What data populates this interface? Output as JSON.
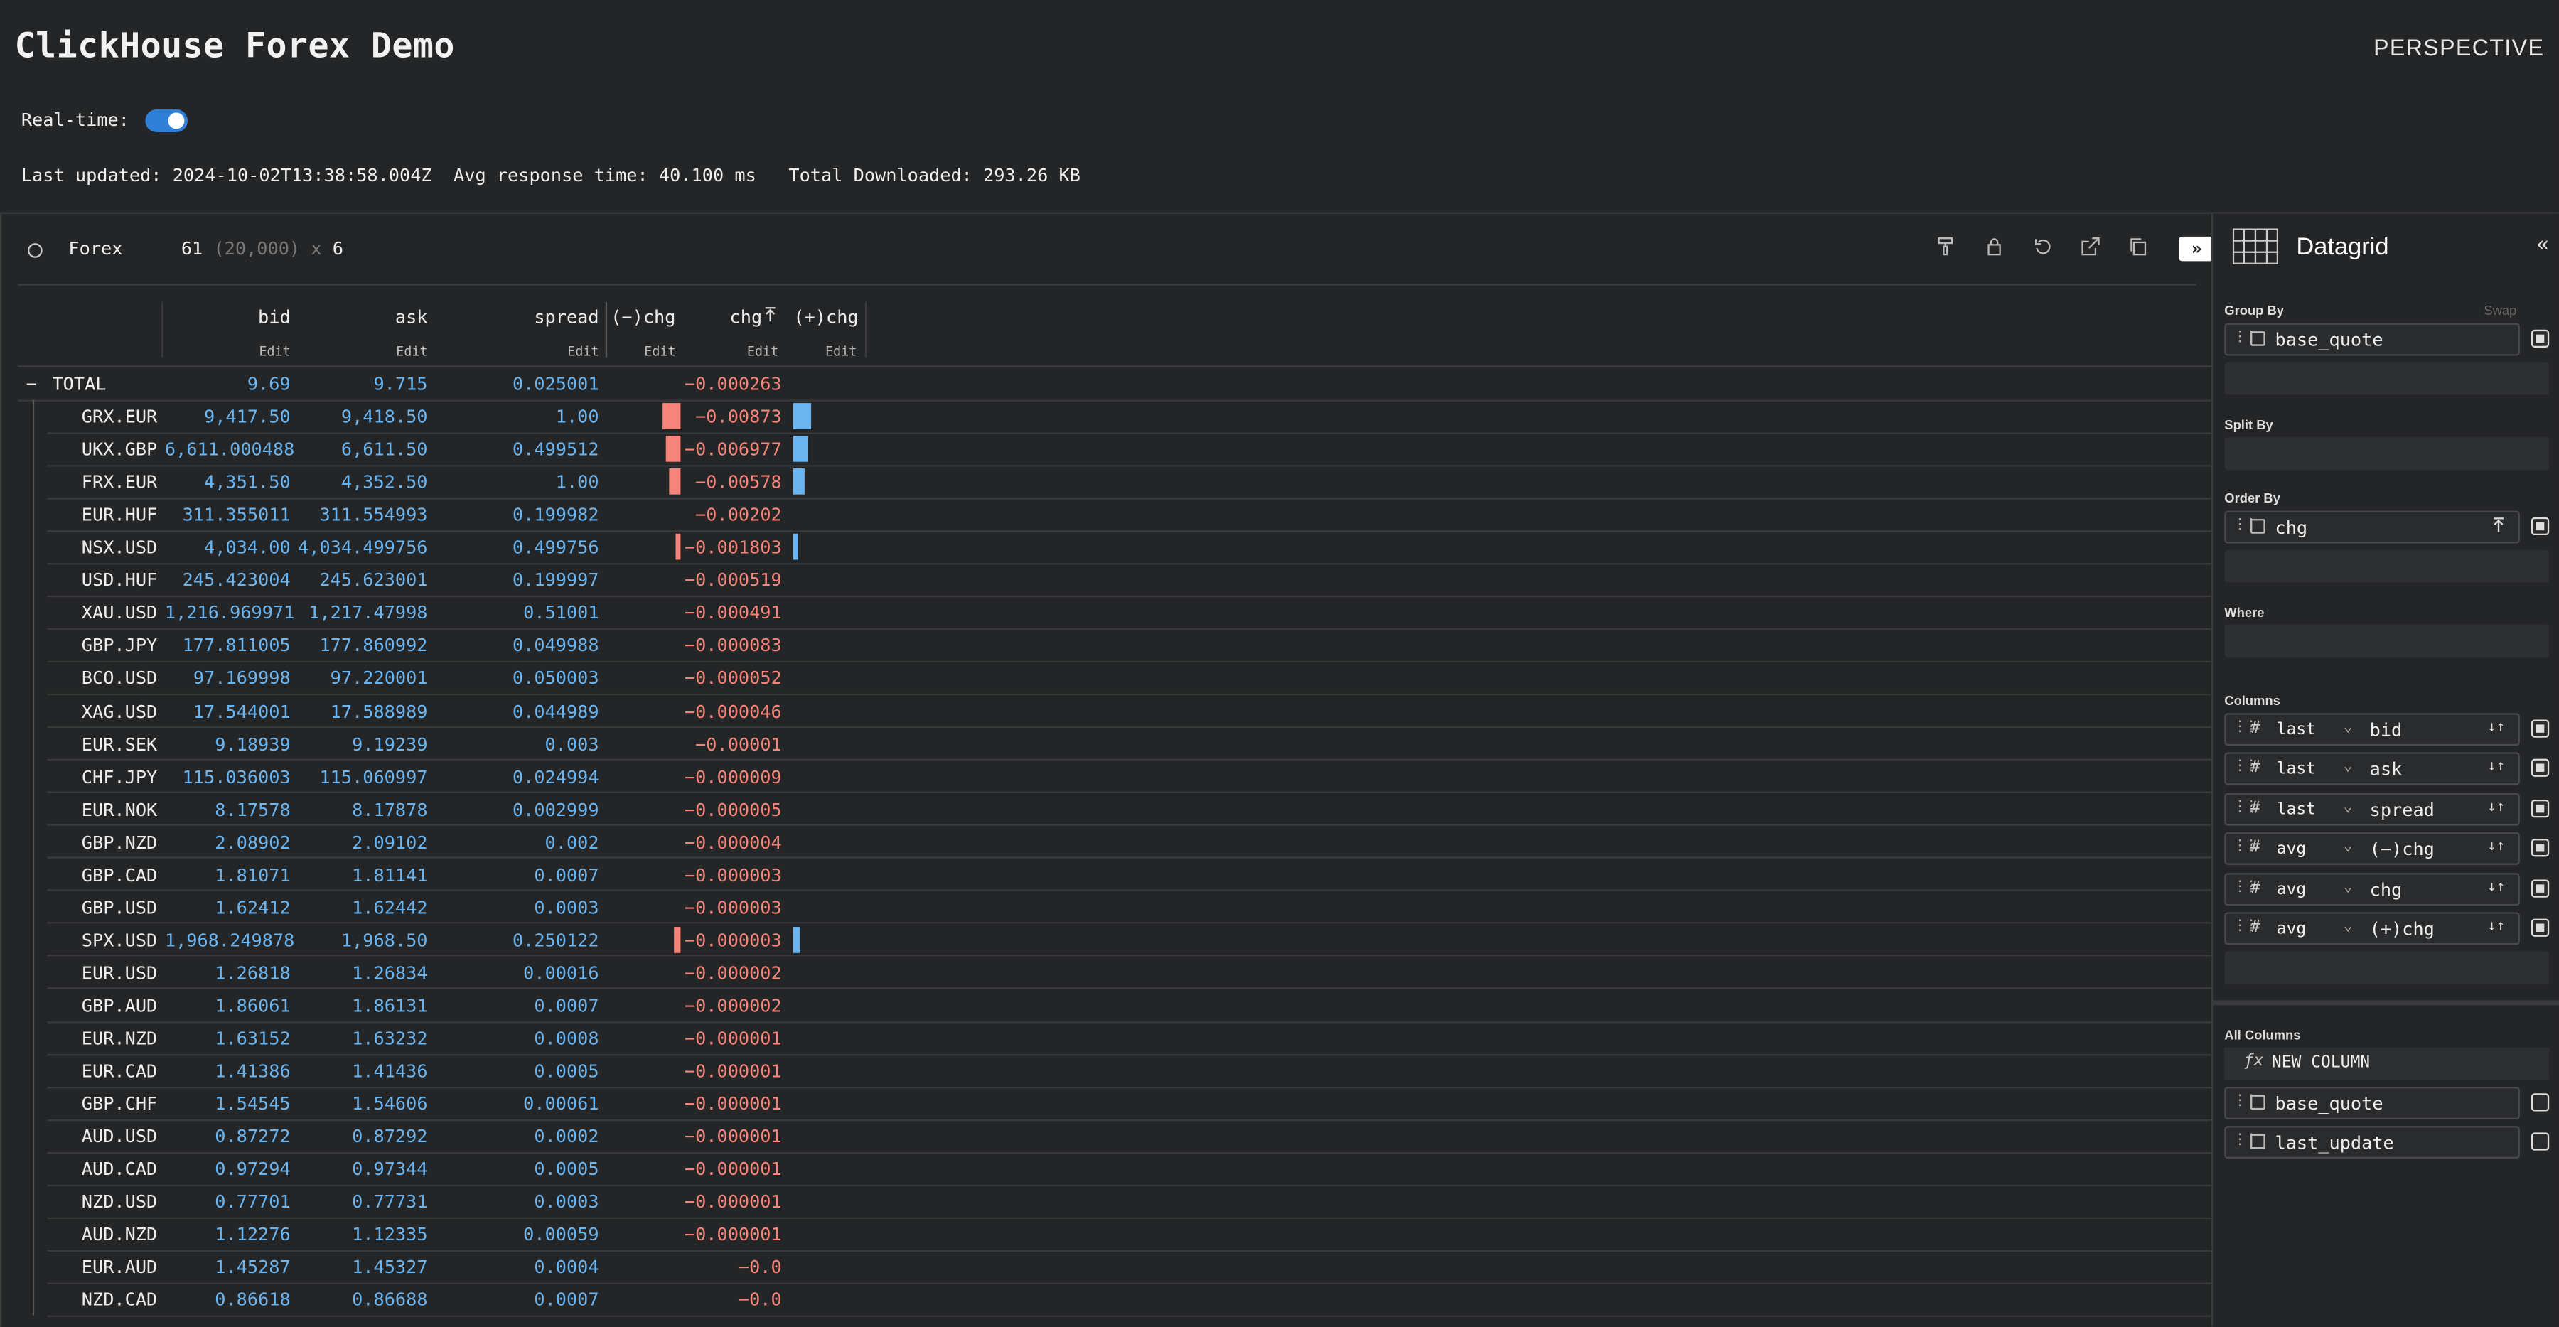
{
  "app": {
    "title": "ClickHouse Forex Demo",
    "brand": "PERSPECTIVE",
    "realtime_label": "Real-time:",
    "realtime_on": true,
    "stats": "Last updated: 2024-10-02T13:38:58.004Z  Avg response time: 40.100 ms   Total Downloaded: 293.26 KB"
  },
  "viewer": {
    "table_name": "Forex",
    "row_count": "61",
    "total_rows": "(20,000)",
    "times": "x",
    "col_count": "6",
    "expand_label": "»"
  },
  "grid": {
    "columns": [
      "bid",
      "ask",
      "spread",
      "(−)chg",
      "chg",
      "(+)chg"
    ],
    "edit_label": "Edit",
    "total_row": {
      "label": "TOTAL",
      "toggle": "−",
      "bid": "9.69",
      "ask": "9.715",
      "spread": "0.025001",
      "chg": "−0.000263"
    },
    "rows": [
      {
        "name": "GRX.EUR",
        "bid": "9,417.50",
        "ask": "9,418.50",
        "spread": "1.00",
        "chg": "−0.00873",
        "bar": 1.0
      },
      {
        "name": "UKX.GBP",
        "bid": "6,611.000488",
        "ask": "6,611.50",
        "spread": "0.499512",
        "chg": "−0.006977",
        "bar": 0.8
      },
      {
        "name": "FRX.EUR",
        "bid": "4,351.50",
        "ask": "4,352.50",
        "spread": "1.00",
        "chg": "−0.00578",
        "bar": 0.66
      },
      {
        "name": "EUR.HUF",
        "bid": "311.355011",
        "ask": "311.554993",
        "spread": "0.199982",
        "chg": "−0.00202",
        "bar": 0
      },
      {
        "name": "NSX.USD",
        "bid": "4,034.00",
        "ask": "4,034.499756",
        "spread": "0.499756",
        "chg": "−0.001803",
        "bar": 0.2
      },
      {
        "name": "USD.HUF",
        "bid": "245.423004",
        "ask": "245.623001",
        "spread": "0.199997",
        "chg": "−0.000519",
        "bar": 0
      },
      {
        "name": "XAU.USD",
        "bid": "1,216.969971",
        "ask": "1,217.47998",
        "spread": "0.51001",
        "chg": "−0.000491",
        "bar": 0
      },
      {
        "name": "GBP.JPY",
        "bid": "177.811005",
        "ask": "177.860992",
        "spread": "0.049988",
        "chg": "−0.000083",
        "bar": 0
      },
      {
        "name": "BCO.USD",
        "bid": "97.169998",
        "ask": "97.220001",
        "spread": "0.050003",
        "chg": "−0.000052",
        "bar": 0
      },
      {
        "name": "XAG.USD",
        "bid": "17.544001",
        "ask": "17.588989",
        "spread": "0.044989",
        "chg": "−0.000046",
        "bar": 0
      },
      {
        "name": "EUR.SEK",
        "bid": "9.18939",
        "ask": "9.19239",
        "spread": "0.003",
        "chg": "−0.00001",
        "bar": 0
      },
      {
        "name": "CHF.JPY",
        "bid": "115.036003",
        "ask": "115.060997",
        "spread": "0.024994",
        "chg": "−0.000009",
        "bar": 0
      },
      {
        "name": "EUR.NOK",
        "bid": "8.17578",
        "ask": "8.17878",
        "spread": "0.002999",
        "chg": "−0.000005",
        "bar": 0
      },
      {
        "name": "GBP.NZD",
        "bid": "2.08902",
        "ask": "2.09102",
        "spread": "0.002",
        "chg": "−0.000004",
        "bar": 0
      },
      {
        "name": "GBP.CAD",
        "bid": "1.81071",
        "ask": "1.81141",
        "spread": "0.0007",
        "chg": "−0.000003",
        "bar": 0
      },
      {
        "name": "GBP.USD",
        "bid": "1.62412",
        "ask": "1.62442",
        "spread": "0.0003",
        "chg": "−0.000003",
        "bar": 0
      },
      {
        "name": "SPX.USD",
        "bid": "1,968.249878",
        "ask": "1,968.50",
        "spread": "0.250122",
        "chg": "−0.000003",
        "bar": 0.4
      },
      {
        "name": "EUR.USD",
        "bid": "1.26818",
        "ask": "1.26834",
        "spread": "0.00016",
        "chg": "−0.000002",
        "bar": 0
      },
      {
        "name": "GBP.AUD",
        "bid": "1.86061",
        "ask": "1.86131",
        "spread": "0.0007",
        "chg": "−0.000002",
        "bar": 0
      },
      {
        "name": "EUR.NZD",
        "bid": "1.63152",
        "ask": "1.63232",
        "spread": "0.0008",
        "chg": "−0.000001",
        "bar": 0
      },
      {
        "name": "EUR.CAD",
        "bid": "1.41386",
        "ask": "1.41436",
        "spread": "0.0005",
        "chg": "−0.000001",
        "bar": 0
      },
      {
        "name": "GBP.CHF",
        "bid": "1.54545",
        "ask": "1.54606",
        "spread": "0.00061",
        "chg": "−0.000001",
        "bar": 0
      },
      {
        "name": "AUD.USD",
        "bid": "0.87272",
        "ask": "0.87292",
        "spread": "0.0002",
        "chg": "−0.000001",
        "bar": 0
      },
      {
        "name": "AUD.CAD",
        "bid": "0.97294",
        "ask": "0.97344",
        "spread": "0.0005",
        "chg": "−0.000001",
        "bar": 0
      },
      {
        "name": "NZD.USD",
        "bid": "0.77701",
        "ask": "0.77731",
        "spread": "0.0003",
        "chg": "−0.000001",
        "bar": 0
      },
      {
        "name": "AUD.NZD",
        "bid": "1.12276",
        "ask": "1.12335",
        "spread": "0.00059",
        "chg": "−0.000001",
        "bar": 0
      },
      {
        "name": "EUR.AUD",
        "bid": "1.45287",
        "ask": "1.45327",
        "spread": "0.0004",
        "chg": "−0.0",
        "bar": 0
      },
      {
        "name": "NZD.CAD",
        "bid": "0.86618",
        "ask": "0.86688",
        "spread": "0.0007",
        "chg": "−0.0",
        "bar": 0
      }
    ]
  },
  "sidebar": {
    "plugin": "Datagrid",
    "collapse": "«",
    "group_by_label": "Group By",
    "swap_label": "Swap",
    "group_by": "base_quote",
    "split_by_label": "Split By",
    "order_by_label": "Order By",
    "order_by": "chg",
    "where_label": "Where",
    "columns_label": "Columns",
    "columns": [
      {
        "agg": "last",
        "name": "bid"
      },
      {
        "agg": "last",
        "name": "ask"
      },
      {
        "agg": "last",
        "name": "spread"
      },
      {
        "agg": "avg",
        "name": "(−)chg"
      },
      {
        "agg": "avg",
        "name": "chg"
      },
      {
        "agg": "avg",
        "name": "(+)chg"
      }
    ],
    "all_columns_label": "All Columns",
    "new_column": "NEW COLUMN",
    "fx_icon": "ƒx",
    "extra_columns": [
      "base_quote",
      "last_update"
    ]
  },
  "colors": {
    "positive": "#6ab4f0",
    "negative": "#f5857a",
    "accent": "#2f7fd8"
  }
}
